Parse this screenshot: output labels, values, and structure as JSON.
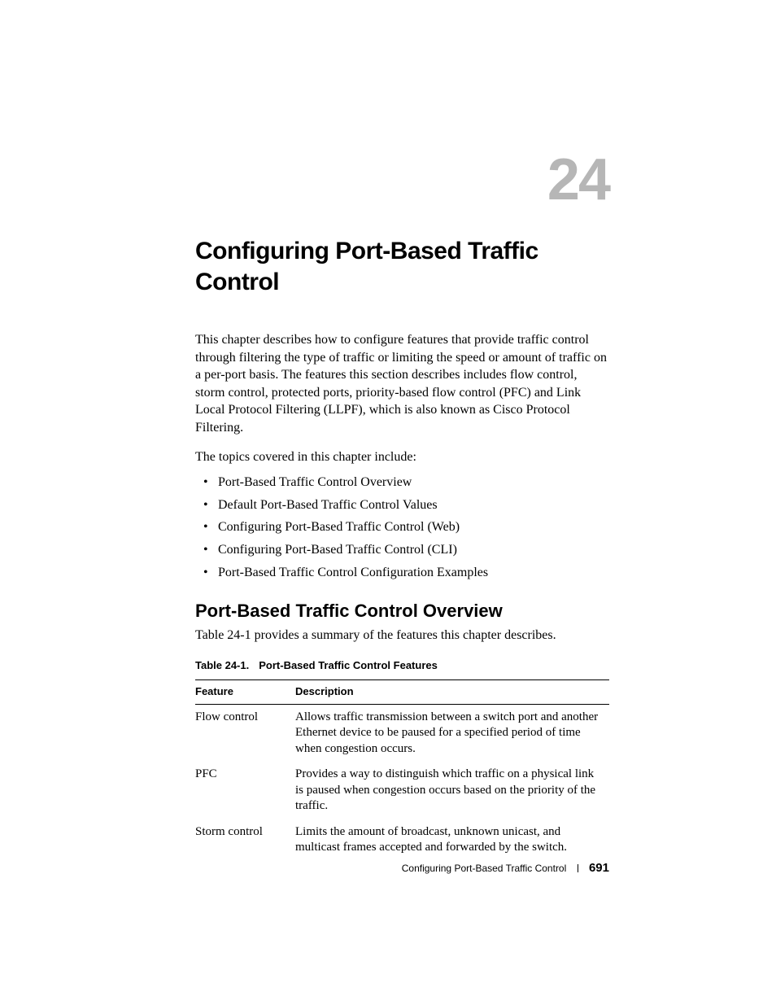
{
  "chapter_number": "24",
  "chapter_title": "Configuring Port-Based Traffic Control",
  "intro": "This chapter describes how to configure features that provide traffic control through filtering the type of traffic or limiting the speed or amount of traffic on a per-port basis. The features this section describes includes flow control, storm control, protected ports, priority-based flow control (PFC) and Link Local Protocol Filtering (LLPF), which is also known as Cisco Protocol Filtering.",
  "topics_intro": "The topics covered in this chapter include:",
  "topics": [
    "Port-Based Traffic Control Overview",
    "Default Port-Based Traffic Control Values",
    "Configuring Port-Based Traffic Control (Web)",
    "Configuring Port-Based Traffic Control (CLI)",
    "Port-Based Traffic Control Configuration Examples"
  ],
  "section_heading": "Port-Based Traffic Control Overview",
  "section_para": "Table 24-1 provides a summary of the features this chapter describes.",
  "table_caption_label": "Table 24-1.",
  "table_caption_title": "Port-Based Traffic Control Features",
  "table": {
    "headers": [
      "Feature",
      "Description"
    ],
    "rows": [
      {
        "feature": "Flow control",
        "description": "Allows traffic transmission between a switch port and another Ethernet device to be paused for a specified period of time when congestion occurs."
      },
      {
        "feature": "PFC",
        "description": "Provides a way to distinguish which traffic on a physical link is paused when congestion occurs based on the priority of the traffic."
      },
      {
        "feature": "Storm control",
        "description": "Limits the amount of broadcast, unknown unicast, and multicast frames accepted and forwarded by the switch."
      }
    ]
  },
  "footer_title": "Configuring Port-Based Traffic Control",
  "footer_page": "691"
}
